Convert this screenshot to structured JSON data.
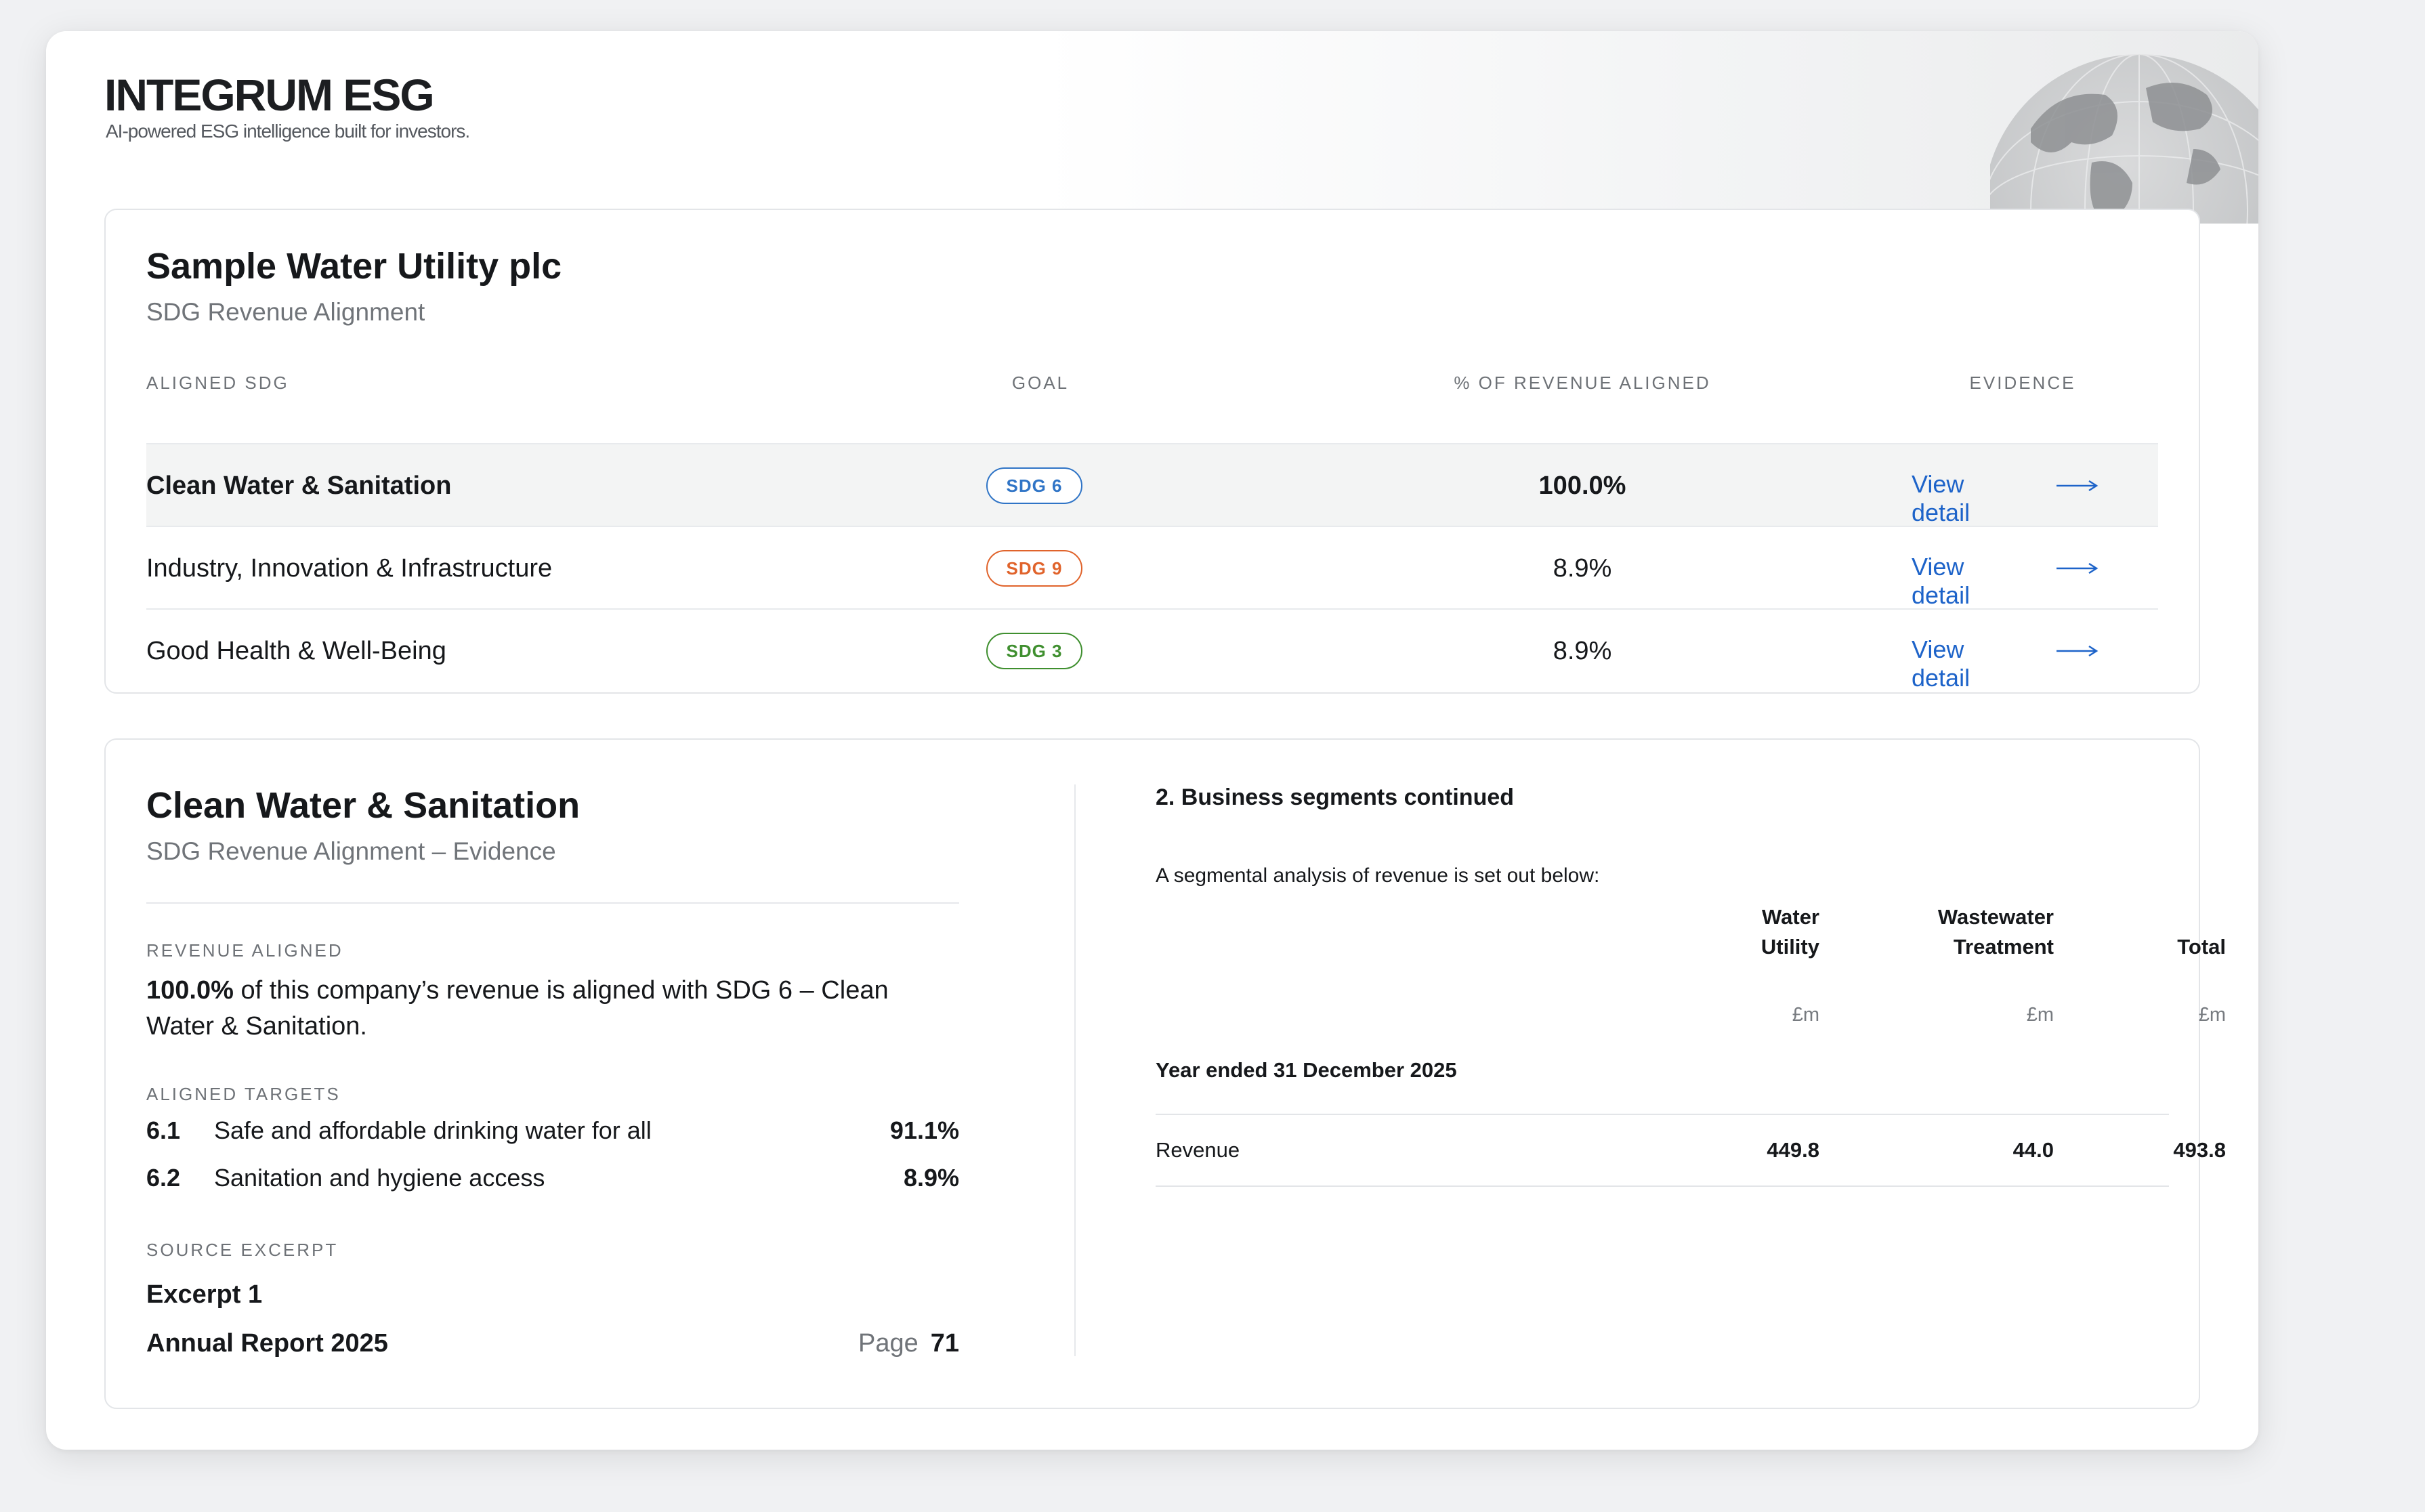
{
  "app": {
    "brand": "INTEGRUM ESG",
    "tagline": "AI-powered ESG intelligence built for investors."
  },
  "summary": {
    "company": "Sample Water Utility plc",
    "subtitle": "SDG Revenue Alignment",
    "columns": {
      "sdg": "ALIGNED SDG",
      "goal": "GOAL",
      "revenue": "% OF REVENUE ALIGNED",
      "evidence": "EVIDENCE"
    },
    "rows": [
      {
        "name": "Clean Water & Sanitation",
        "goal": "SDG 6",
        "pct": "100.0%",
        "link": "View detail",
        "color": "#2f74c6"
      },
      {
        "name": "Industry, Innovation & Infrastructure",
        "goal": "SDG 9",
        "pct": "8.9%",
        "link": "View detail",
        "color": "#e0632b"
      },
      {
        "name": "Good Health & Well-Being",
        "goal": "SDG 3",
        "pct": "8.9%",
        "link": "View detail",
        "color": "#3f8f2f"
      }
    ]
  },
  "evidence": {
    "title": "Clean Water & Sanitation",
    "subtitle": "SDG Revenue Alignment – Evidence",
    "revenue_label": "REVENUE ALIGNED",
    "revenue_pct": "100.0%",
    "revenue_text": " of this company’s revenue is aligned with SDG 6 – Clean Water & Sanitation.",
    "targets_label": "ALIGNED TARGETS",
    "targets": [
      {
        "num": "6.1",
        "label": "Safe and affordable drinking water for all",
        "pct": "91.1%"
      },
      {
        "num": "6.2",
        "label": "Sanitation and hygiene access",
        "pct": "8.9%"
      }
    ],
    "source_label": "SOURCE EXCERPT",
    "excerpt": "Excerpt 1",
    "report": "Annual Report 2025",
    "page_label": "Page",
    "page_num": "71"
  },
  "document": {
    "heading": "2. Business segments continued",
    "intro": "A segmental analysis of revenue is set out below:",
    "col1": [
      "Water",
      "Utility"
    ],
    "col2": [
      "Wastewater",
      "Treatment"
    ],
    "col3": "Total",
    "unit": "£m",
    "period": "Year ended 31 December 2025",
    "row_label": "Revenue",
    "values": [
      "449.8",
      "44.0",
      "493.8"
    ]
  }
}
